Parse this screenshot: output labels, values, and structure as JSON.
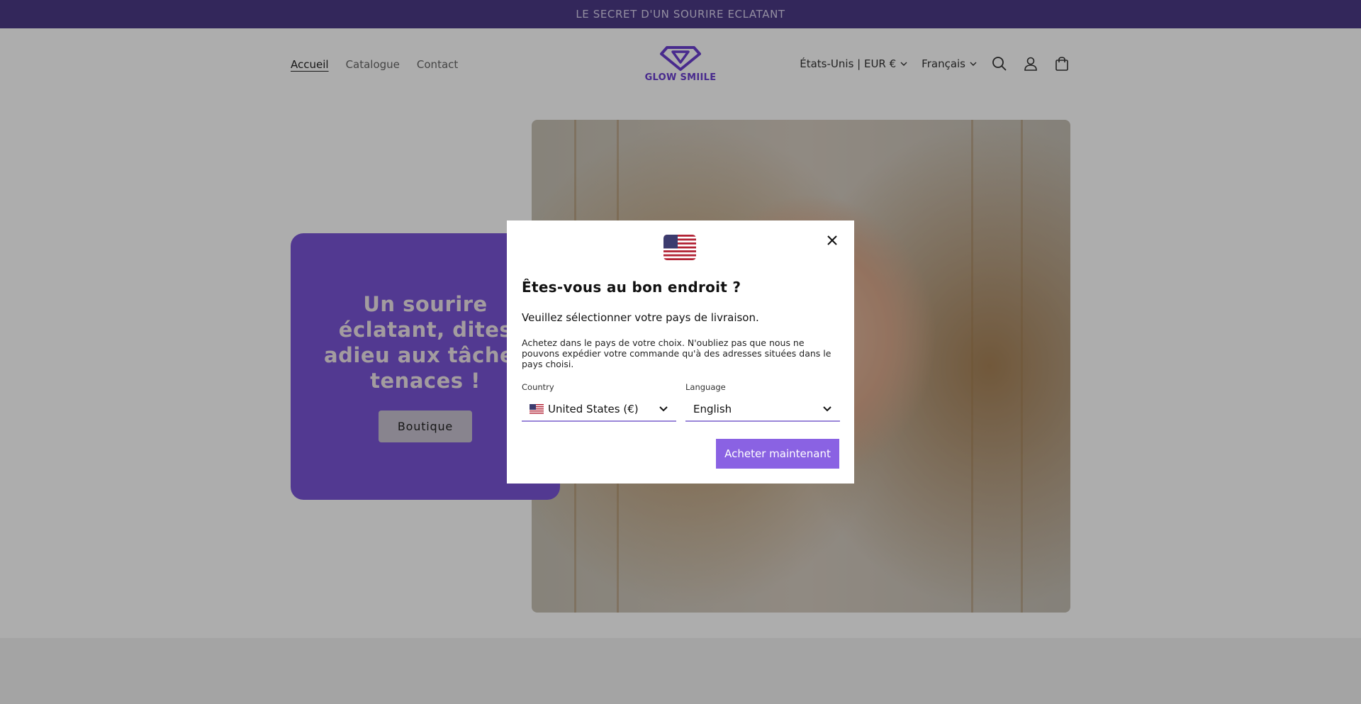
{
  "announcement": {
    "text": "LE SECRET D'UN SOURIRE ECLATANT"
  },
  "header": {
    "nav": [
      {
        "label": "Accueil"
      },
      {
        "label": "Catalogue"
      },
      {
        "label": "Contact"
      }
    ],
    "logo_text": "GLOW SMIILE",
    "region_selector": "États-Unis | EUR €",
    "language_selector": "Français",
    "icons": [
      "search-icon",
      "account-icon",
      "cart-icon"
    ]
  },
  "hero": {
    "title": "Un sourire éclatant, dites adieu aux tâches tenaces !",
    "button_label": "Boutique"
  },
  "modal": {
    "flag_icon": "us-flag-icon",
    "title": "Êtes-vous au bon endroit ?",
    "subtitle": "Veuillez sélectionner votre pays de livraison.",
    "note": "Achetez dans le pays de votre choix. N'oubliez pas que nous ne pouvons expédier votre commande qu'à des adresses situées dans le pays choisi.",
    "country_label": "Country",
    "country_value": "United States (€)",
    "language_label": "Language",
    "language_value": "English",
    "buy_button": "Acheter maintenant"
  },
  "colors": {
    "announcement_bg": "#4c3a86",
    "brand_purple": "#6b3fd0",
    "hero_card_bg": "#7a55d6",
    "buy_button_bg": "#8a62e3"
  }
}
